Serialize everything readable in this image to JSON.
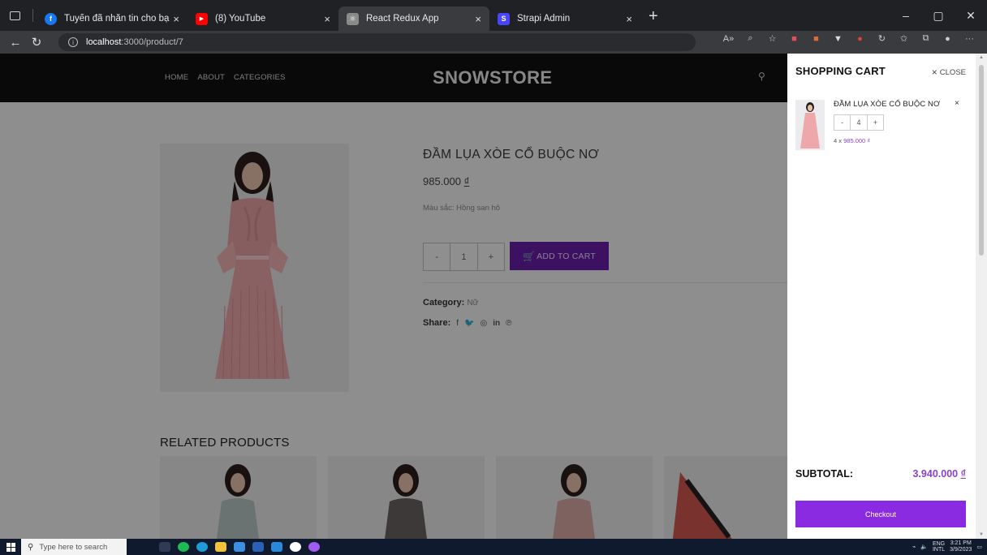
{
  "browser": {
    "tabs": [
      {
        "label": "Tuyến đã nhắn tin cho bạn",
        "fav_color": "#1877f2",
        "fav_glyph": "f"
      },
      {
        "label": "(8) YouTube",
        "fav_color": "#ff0000",
        "fav_glyph": "▶"
      },
      {
        "label": "React Redux App",
        "fav_color": "#8a8a8a",
        "fav_glyph": "⚛"
      },
      {
        "label": "Strapi Admin",
        "fav_color": "#4945ff",
        "fav_glyph": "S"
      }
    ],
    "tab_close": "×",
    "new_tab": "+",
    "url_host": "localhost",
    "url_path": ":3000/product/7"
  },
  "site": {
    "nav": [
      "HOME",
      "ABOUT",
      "CATEGORIES"
    ],
    "logo": "SNOWSTORE"
  },
  "product": {
    "title": "ĐẦM LỤA XÒE CỔ BUỘC NƠ",
    "price": "985.000",
    "currency": "₫",
    "color_text": "Màu sắc: Hồng san hô",
    "qty_minus": "-",
    "qty_value": "1",
    "qty_plus": "+",
    "add_to_cart": "ADD TO CART",
    "category_label": "Category:",
    "category_value": "Nữ",
    "share_label": "Share:"
  },
  "related": {
    "title": "RELATED PRODUCTS"
  },
  "cart": {
    "title": "SHOPPING CART",
    "close_label": "CLOSE",
    "item": {
      "name": "ĐẦM LỤA XÒE CỔ BUỘC NƠ",
      "remove": "×",
      "qty_minus": "-",
      "qty_value": "4",
      "qty_plus": "+",
      "qty_prefix": "4 x",
      "unit_price": "985.000 ₫"
    },
    "subtotal_label": "SUBTOTAL:",
    "subtotal_value": "3.940.000",
    "subtotal_currency": "₫",
    "checkout_label": "Checkout"
  },
  "taskbar": {
    "search_placeholder": "Type here to search",
    "lang_top": "ENG",
    "lang_bottom": "INTL",
    "time": "3:21 PM",
    "date": "3/9/2023"
  }
}
